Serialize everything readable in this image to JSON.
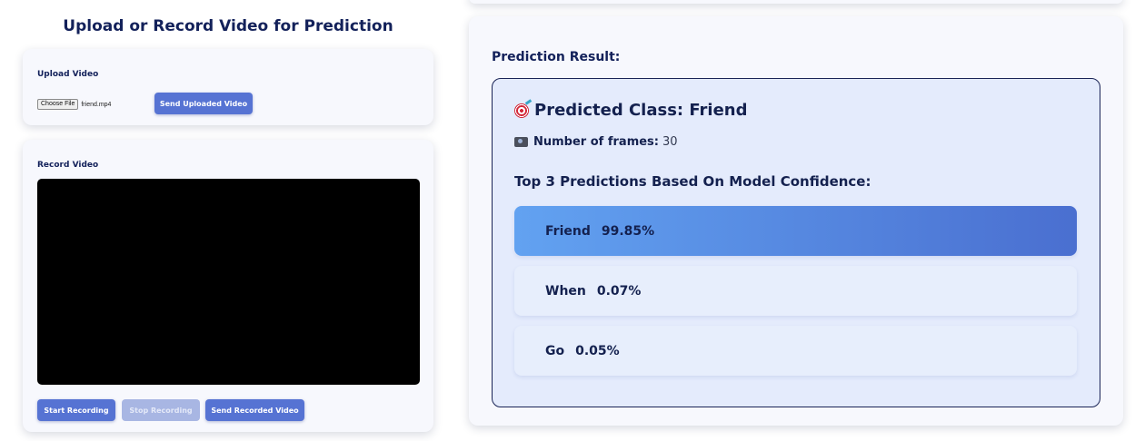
{
  "page": {
    "title": "Upload or Record Video for Prediction"
  },
  "upload": {
    "heading": "Upload Video",
    "choose_file_label": "Choose File",
    "file_name": "friend.mp4",
    "send_button": "Send Uploaded Video"
  },
  "record": {
    "heading": "Record Video",
    "start_button": "Start Recording",
    "stop_button": "Stop Recording",
    "stop_disabled": true,
    "send_button": "Send Recorded Video"
  },
  "result": {
    "heading": "Prediction Result:",
    "predicted_class_text": "Predicted Class: Friend",
    "predicted_icon": "target-icon",
    "frames_label": "Number of frames:",
    "frames_value": "30",
    "frames_icon": "camera-icon",
    "top_heading": "Top 3 Predictions Based On Model Confidence:",
    "predictions": [
      {
        "label": "Friend",
        "confidence": "99.85%"
      },
      {
        "label": "When",
        "confidence": "0.07%"
      },
      {
        "label": "Go",
        "confidence": "0.05%"
      }
    ]
  },
  "colors": {
    "primary_button": "#5673d3",
    "disabled_button": "#a8b6e3",
    "heading_text": "#13215a",
    "result_box_bg": "#e4ebfc",
    "top_prediction_gradient_start": "#62a2f1",
    "top_prediction_gradient_end": "#4a6fd0"
  }
}
